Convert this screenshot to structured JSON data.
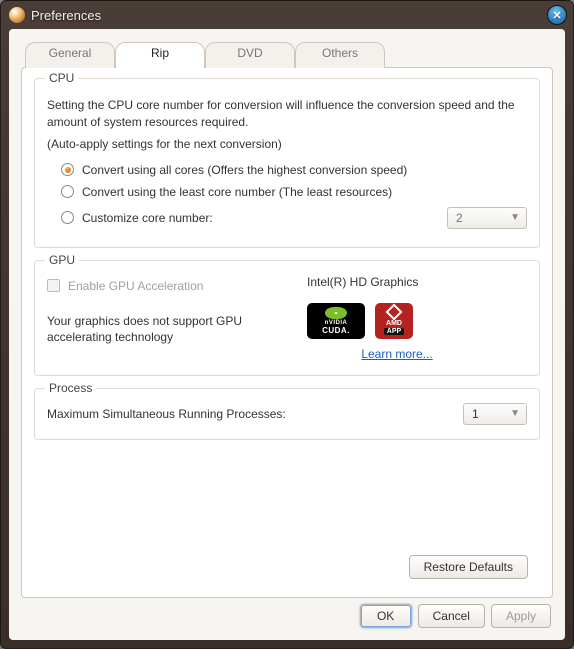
{
  "window": {
    "title": "Preferences"
  },
  "tabs": {
    "general": "General",
    "rip": "Rip",
    "dvd": "DVD",
    "others": "Others"
  },
  "cpu": {
    "legend": "CPU",
    "desc": "Setting the CPU core number for conversion will influence the conversion speed and the amount of system resources required.",
    "note": "(Auto-apply settings for the next conversion)",
    "opt_all": "Convert using all cores (Offers the highest conversion speed)",
    "opt_least": "Convert using the least core number (The least resources)",
    "opt_custom": "Customize core number:",
    "core_value": "2"
  },
  "gpu": {
    "legend": "GPU",
    "enable_label": "Enable GPU Acceleration",
    "device": "Intel(R) HD Graphics",
    "unsupported": "Your graphics does not support GPU accelerating technology",
    "nvidia_brand": "nVIDIA",
    "nvidia_tech": "CUDA.",
    "amd_brand": "AMD",
    "amd_tech": "APP",
    "learn_more": "Learn more..."
  },
  "process": {
    "legend": "Process",
    "label": "Maximum Simultaneous Running Processes:",
    "value": "1"
  },
  "buttons": {
    "restore": "Restore Defaults",
    "ok": "OK",
    "cancel": "Cancel",
    "apply": "Apply"
  }
}
